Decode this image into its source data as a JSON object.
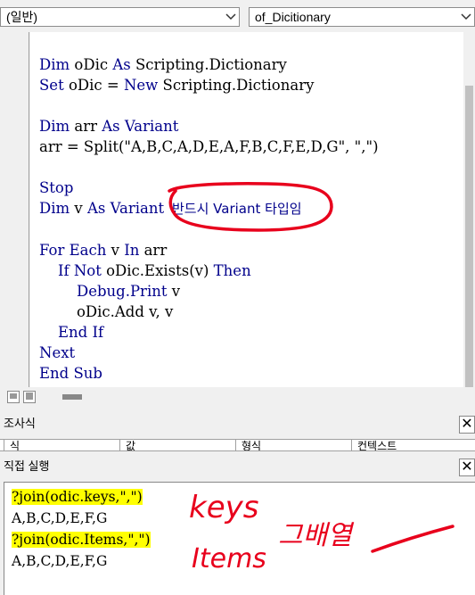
{
  "object_combo": {
    "value": "(일반)"
  },
  "proc_combo": {
    "value": "of_Dicitionary"
  },
  "code": {
    "l1_kw1": "Dim",
    "l1_rest1": " oDic ",
    "l1_kw2": "As",
    "l1_rest2": " Scripting.Dictionary",
    "l2_kw1": "Set",
    "l2_rest1": " oDic = ",
    "l2_kw2": "New",
    "l2_rest2": " Scripting.Dictionary",
    "l3_kw1": "Dim",
    "l3_rest1": " arr ",
    "l3_kw2": "As Variant",
    "l4": "arr = Split(\"A,B,C,A,D,E,A,F,B,C,F,E,D,G\", \",\")",
    "l5_kw": "Stop",
    "l6_kw1": "Dim",
    "l6_rest1": " v ",
    "l6_kw2": "As Variant",
    "l6_comment": " '반드시 Variant 타입임",
    "l7_kw1": "For Each",
    "l7_rest1": " v ",
    "l7_kw2": "In",
    "l7_rest2": " arr",
    "l8_kw1": "If Not",
    "l8_rest1": " oDic.Exists(v) ",
    "l8_kw2": "Then",
    "l9_kw1": "Debug.Print",
    "l9_rest1": " v",
    "l10": "oDic.Add v, v",
    "l11_kw": "End If",
    "l12_kw": "Next",
    "l13_kw": "End Sub"
  },
  "watch": {
    "title": "조사식",
    "columns": [
      "식",
      "값",
      "형식",
      "컨텍스트"
    ]
  },
  "immediate": {
    "title": "직접 실행",
    "lines": [
      "?join(odic.keys,\",\")",
      "A,B,C,D,E,F,G",
      "?join(odic.Items,\",\")",
      "A,B,C,D,E,F,G"
    ]
  },
  "annotations": {
    "keys_label": "keys",
    "items_label": "Items",
    "array_label": "그배열"
  },
  "colors": {
    "keyword": "#00008b",
    "highlight": "#ffff00",
    "annotation": "#e8001c"
  }
}
